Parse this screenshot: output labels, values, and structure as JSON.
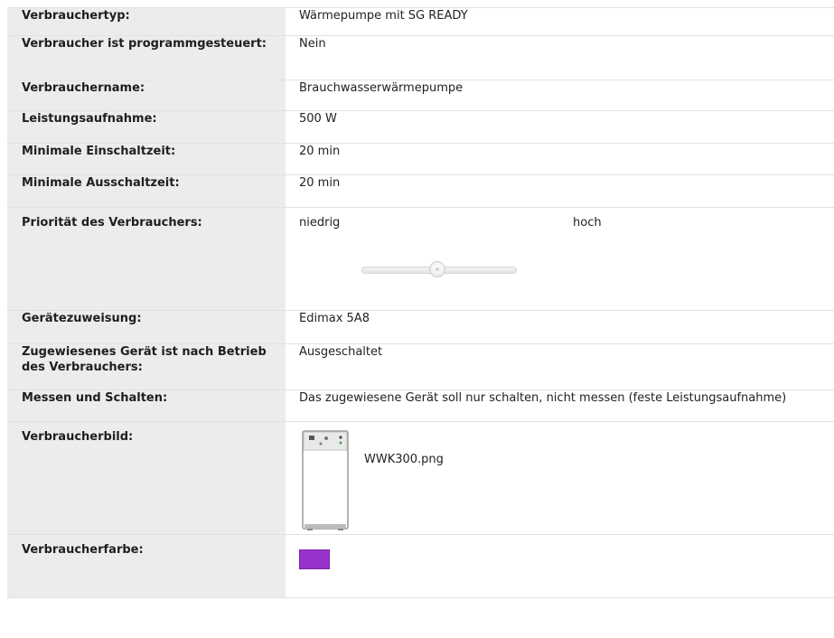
{
  "rows": [
    {
      "label": "Verbrauchertyp:",
      "value": "Wärmepumpe mit SG READY"
    },
    {
      "label": "Verbraucher ist programmgesteuert:",
      "value": "Nein"
    },
    {
      "label": "Verbrauchername:",
      "value": "Brauchwasserwärmepumpe"
    },
    {
      "label": "Leistungsaufnahme:",
      "value": "500 W"
    },
    {
      "label": "Minimale Einschaltzeit:",
      "value": "20 min"
    },
    {
      "label": "Minimale Ausschaltzeit:",
      "value": "20 min"
    },
    {
      "label": "Priorität des Verbrauchers:",
      "low_label": "niedrig",
      "high_label": "hoch",
      "slider_value_fraction": 0.49
    },
    {
      "label": "Gerätezuweisung:",
      "value": "Edimax 5A8"
    },
    {
      "label": "Zugewiesenes Gerät ist nach Betrieb des Verbrauchers:",
      "value": "Ausgeschaltet"
    },
    {
      "label": "Messen und Schalten:",
      "value": "Das zugewiesene Gerät soll nur schalten, nicht messen (feste Leistungsaufnahme)"
    },
    {
      "label": "Verbraucherbild:",
      "image_name": "WWK300.png",
      "icon": "water-heat-pump-device-icon"
    },
    {
      "label": "Verbraucherfarbe:",
      "color": "#9932cc"
    }
  ]
}
